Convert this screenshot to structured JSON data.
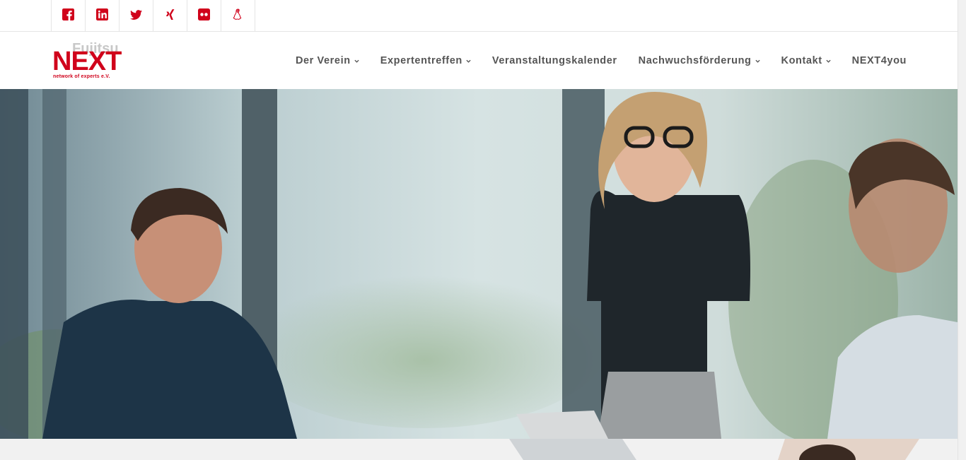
{
  "social_links": [
    {
      "name": "facebook",
      "icon": "facebook-icon"
    },
    {
      "name": "linkedin",
      "icon": "linkedin-icon"
    },
    {
      "name": "twitter",
      "icon": "twitter-icon"
    },
    {
      "name": "xing",
      "icon": "xing-icon"
    },
    {
      "name": "flickr",
      "icon": "flickr-icon"
    },
    {
      "name": "linux",
      "icon": "linux-icon"
    }
  ],
  "logo": {
    "brand_top": "Fujitsu",
    "brand_main": "NEXT",
    "tagline": "network of experts e.V."
  },
  "nav": {
    "items": [
      {
        "label": "Der Verein",
        "has_dropdown": true
      },
      {
        "label": "Expertentreffen",
        "has_dropdown": true
      },
      {
        "label": "Veranstaltungskalender",
        "has_dropdown": false
      },
      {
        "label": "Nachwuchsförderung",
        "has_dropdown": true
      },
      {
        "label": "Kontakt",
        "has_dropdown": true
      },
      {
        "label": "NEXT4you",
        "has_dropdown": false
      }
    ]
  },
  "colors": {
    "accent": "#d0021b",
    "nav_text": "#555555",
    "logo_gray": "#c8c8c8",
    "bottom_band": "#f1f1f1"
  }
}
